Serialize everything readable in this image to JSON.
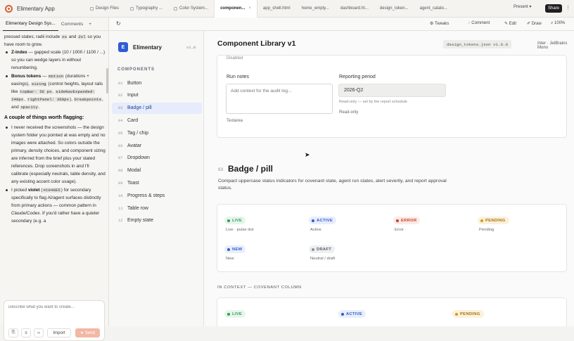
{
  "titlebar": {
    "app_title": "Elimentary App",
    "tabs": [
      {
        "label": "Design Files"
      },
      {
        "label": "Typography ..."
      },
      {
        "label": "Color System..."
      },
      {
        "label": "componen..."
      },
      {
        "label": "app_shell.html"
      },
      {
        "label": "home_empty..."
      },
      {
        "label": "dashboard.ht..."
      },
      {
        "label": "design_token..."
      },
      {
        "label": "agent_catalo..."
      }
    ],
    "close_glyph": "×",
    "present_label": "Present",
    "share_label": "Share"
  },
  "toolbar": {
    "tweaks_label": "Tweaks",
    "comment_label": "Comment",
    "edit_label": "Edit",
    "draw_label": "Draw",
    "zoom": "100%"
  },
  "left_panel": {
    "tabs": [
      "Elimentary Design Sys...",
      "Comments"
    ],
    "chat": {
      "intro_1": "pressed states; radii include",
      "intro_code_1": "xs",
      "intro_2": "and",
      "intro_code_2": "2xl",
      "intro_3": "so you have room to grow.",
      "z_index_bold": "Z-index",
      "z_index_text": "— gapped scale (10 / 1000 / 1100 / ...) so you can wedge layers in without renumbering.",
      "bonus_bold": "Bonus tokens",
      "bonus_text_1": "—",
      "bonus_code_1": "motion",
      "bonus_text_2": "(durations + easings),",
      "bonus_code_2": "sizing",
      "bonus_text_3": "(control heights, layout rails like",
      "bonus_code_3": "topBar: 56 px",
      "bonus_text_4": ",",
      "bonus_code_4": "sideNavExpanded: 240px",
      "bonus_text_5": ",",
      "bonus_code_5": "rightPanel: 360px",
      "bonus_text_6": "),",
      "bonus_code_6": "breakpoints",
      "bonus_text_7": ", and",
      "bonus_code_7": "opacity",
      "bonus_text_8": ".",
      "heading": "A couple of things worth flagging:",
      "flag_1": "I never received the screenshots — the design system folder you pointed at was empty and no images were attached. So colors outside the primary, density choices, and component sizing are inferred from the brief plus your stated references. Drop screenshots in and I'll calibrate (especially neutrals, table density, and any existing accent color usage).",
      "flag_2_a": "I picked",
      "flag_2_bold": "violet",
      "flag_2_code": "#C046E5",
      "flag_2_b": "for secondary specifically to flag AI/agent surfaces distinctly from primary actions — common pattern in Claude/Codex. If you'd rather have a quieter secondary (e.g. a"
    },
    "composer": {
      "placeholder": "Describe what you want to create...",
      "import_label": "Import",
      "send_label": "Send"
    }
  },
  "nav": {
    "brand_letter": "E",
    "brand_name": "Elimentary",
    "version": "v1.0",
    "heading": "COMPONENTS",
    "items": [
      {
        "num": "01",
        "label": "Button"
      },
      {
        "num": "02",
        "label": "Input"
      },
      {
        "num": "03",
        "label": "Badge / pill"
      },
      {
        "num": "04",
        "label": "Card"
      },
      {
        "num": "05",
        "label": "Tag / chip"
      },
      {
        "num": "06",
        "label": "Avatar"
      },
      {
        "num": "07",
        "label": "Dropdown"
      },
      {
        "num": "08",
        "label": "Modal"
      },
      {
        "num": "09",
        "label": "Toast"
      },
      {
        "num": "10",
        "label": "Progress & steps"
      },
      {
        "num": "11",
        "label": "Table row"
      },
      {
        "num": "12",
        "label": "Empty state"
      }
    ],
    "active_index": 2
  },
  "main": {
    "page_title": "Component Library v1",
    "file_badge": "design_tokens.json v1.0.0",
    "font_label": "Inter · JetBrains Mono",
    "card1": {
      "disabled_label": "Disabled",
      "run_notes_label": "Run notes",
      "run_notes_placeholder": "Add context for the audit log...",
      "textarea_caption": "Textarea",
      "period_label": "Reporting period",
      "period_value": "2026-Q2",
      "period_help": "Read-only — set by the report schedule",
      "period_caption": "Read-only"
    },
    "section": {
      "num": "03",
      "title": "Badge / pill",
      "description": "Compact uppercase status indicators for covenant state, agent run states, alert severity, and report approval status."
    },
    "badges": [
      {
        "label": "LIVE",
        "caption": "Live · pulse dot",
        "color": "#2f9e55",
        "bg": "#e7f5ec",
        "dot": "#2f9e55"
      },
      {
        "label": "ACTIVE",
        "caption": "Active",
        "color": "#2f5bd3",
        "bg": "#e8eefb",
        "dot": "#2f5bd3"
      },
      {
        "label": "ERROR",
        "caption": "Error",
        "color": "#c8402e",
        "bg": "#fbeae7",
        "dot": "#c8402e"
      },
      {
        "label": "PENDING",
        "caption": "Pending",
        "color": "#a5730f",
        "bg": "#fbf1dc",
        "dot": "#d69a1c"
      },
      {
        "label": "NEW",
        "caption": "New",
        "color": "#2f5bd3",
        "bg": "#e8eefb",
        "dot": "#2f5bd3"
      },
      {
        "label": "DRAFT",
        "caption": "Neutral / draft",
        "color": "#555b66",
        "bg": "#eeeff1",
        "dot": "#8b909a"
      }
    ],
    "context_label": "IN CONTEXT — COVENANT COLUMN",
    "context_badges": [
      {
        "label": "LIVE",
        "color": "#2f9e55",
        "bg": "#e7f5ec",
        "dot": "#2f9e55"
      },
      {
        "label": "ACTIVE",
        "color": "#2f5bd3",
        "bg": "#e8eefb",
        "dot": "#2f5bd3"
      },
      {
        "label": "PENDING",
        "color": "#a5730f",
        "bg": "#fbf1dc",
        "dot": "#d69a1c"
      }
    ]
  }
}
